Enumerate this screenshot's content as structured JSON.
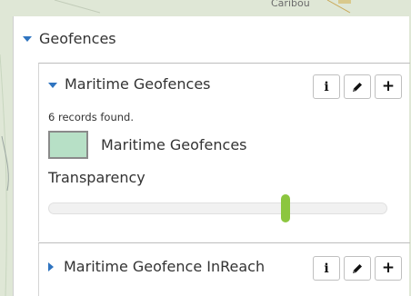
{
  "map": {
    "place_label": "Caribou"
  },
  "geofences_panel": {
    "title": "Geofences",
    "layers": [
      {
        "name": "Maritime Geofences",
        "expanded": true,
        "records_text": "6 records found.",
        "legend_label": "Maritime Geofences",
        "legend_color": "#b7e0c6",
        "transparency_label": "Transparency",
        "transparency_value_fraction": 0.7,
        "buttons": {
          "info": "i",
          "edit_icon": "pencil-icon",
          "add": "+"
        }
      },
      {
        "name": "Maritime Geofence InReach",
        "expanded": false,
        "buttons": {
          "info": "i",
          "edit_icon": "pencil-icon",
          "add": "+"
        }
      }
    ]
  },
  "colors": {
    "accent_blue": "#2f74c0",
    "slider_handle": "#8cc63f"
  }
}
